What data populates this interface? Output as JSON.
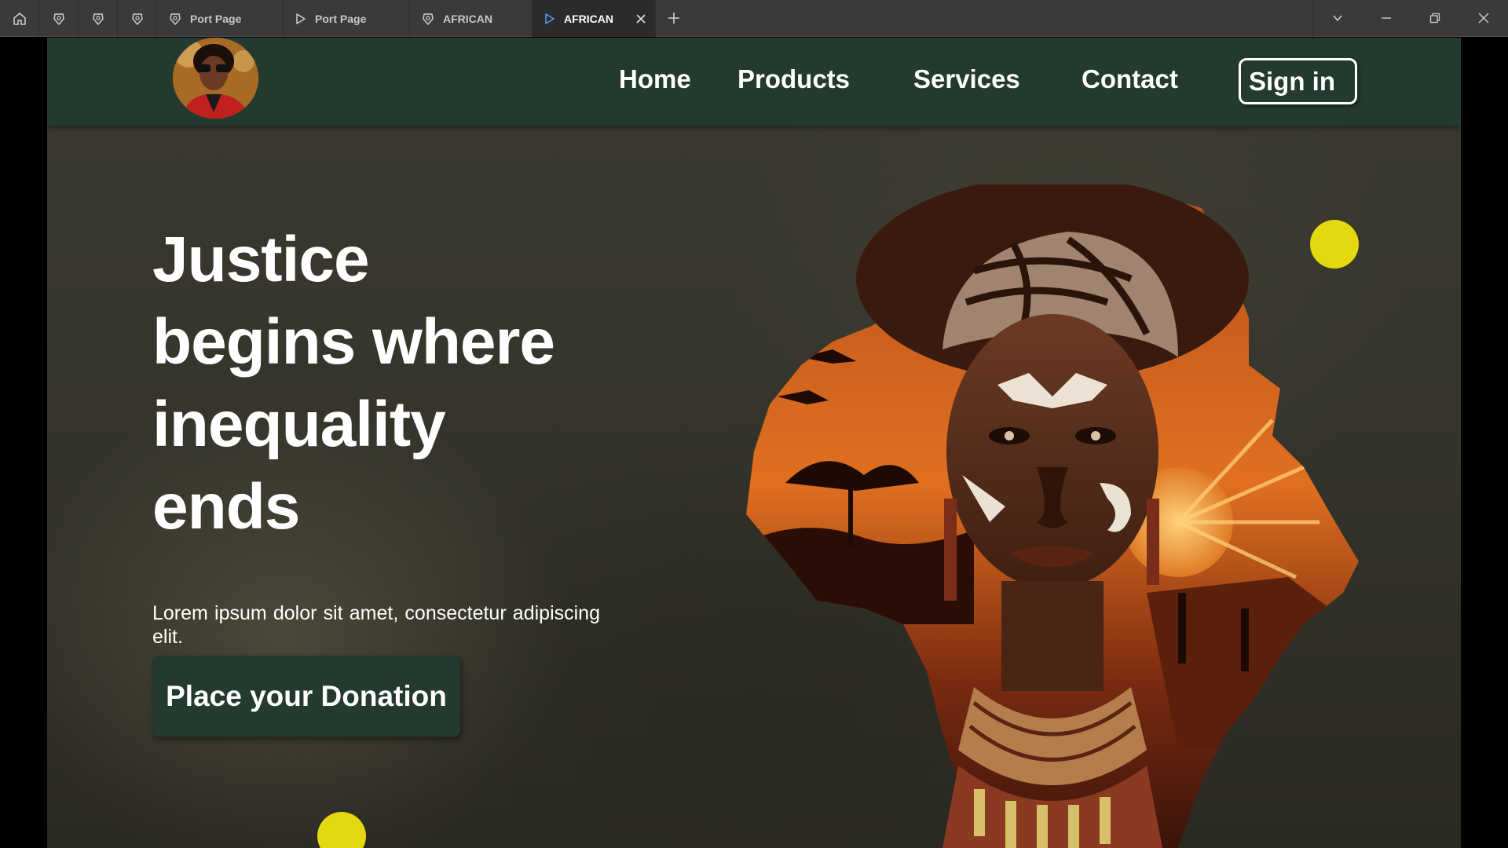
{
  "browser": {
    "tabs": [
      {
        "label": "Port Page",
        "icon": "brave-shield-icon",
        "active": false
      },
      {
        "label": "Port Page",
        "icon": "play-triangle-icon",
        "active": false
      },
      {
        "label": "AFRICAN",
        "icon": "brave-shield-icon",
        "active": false
      },
      {
        "label": "AFRICAN",
        "icon": "play-triangle-icon",
        "active": true
      }
    ]
  },
  "site": {
    "nav": {
      "home": "Home",
      "products": "Products",
      "services": "Services",
      "contact": "Contact",
      "signin": "Sign in"
    },
    "hero": {
      "headline_lines": [
        "Justice",
        "begins where",
        "inequality",
        "ends"
      ],
      "subtext": "Lorem ipsum dolor sit amet, consectetur adipiscing elit.",
      "cta": "Place your Donation"
    }
  },
  "colors": {
    "navbar": "#243a2f",
    "accent_dot": "#e4d80f",
    "background": "#3a392f",
    "text": "#ffffff"
  }
}
